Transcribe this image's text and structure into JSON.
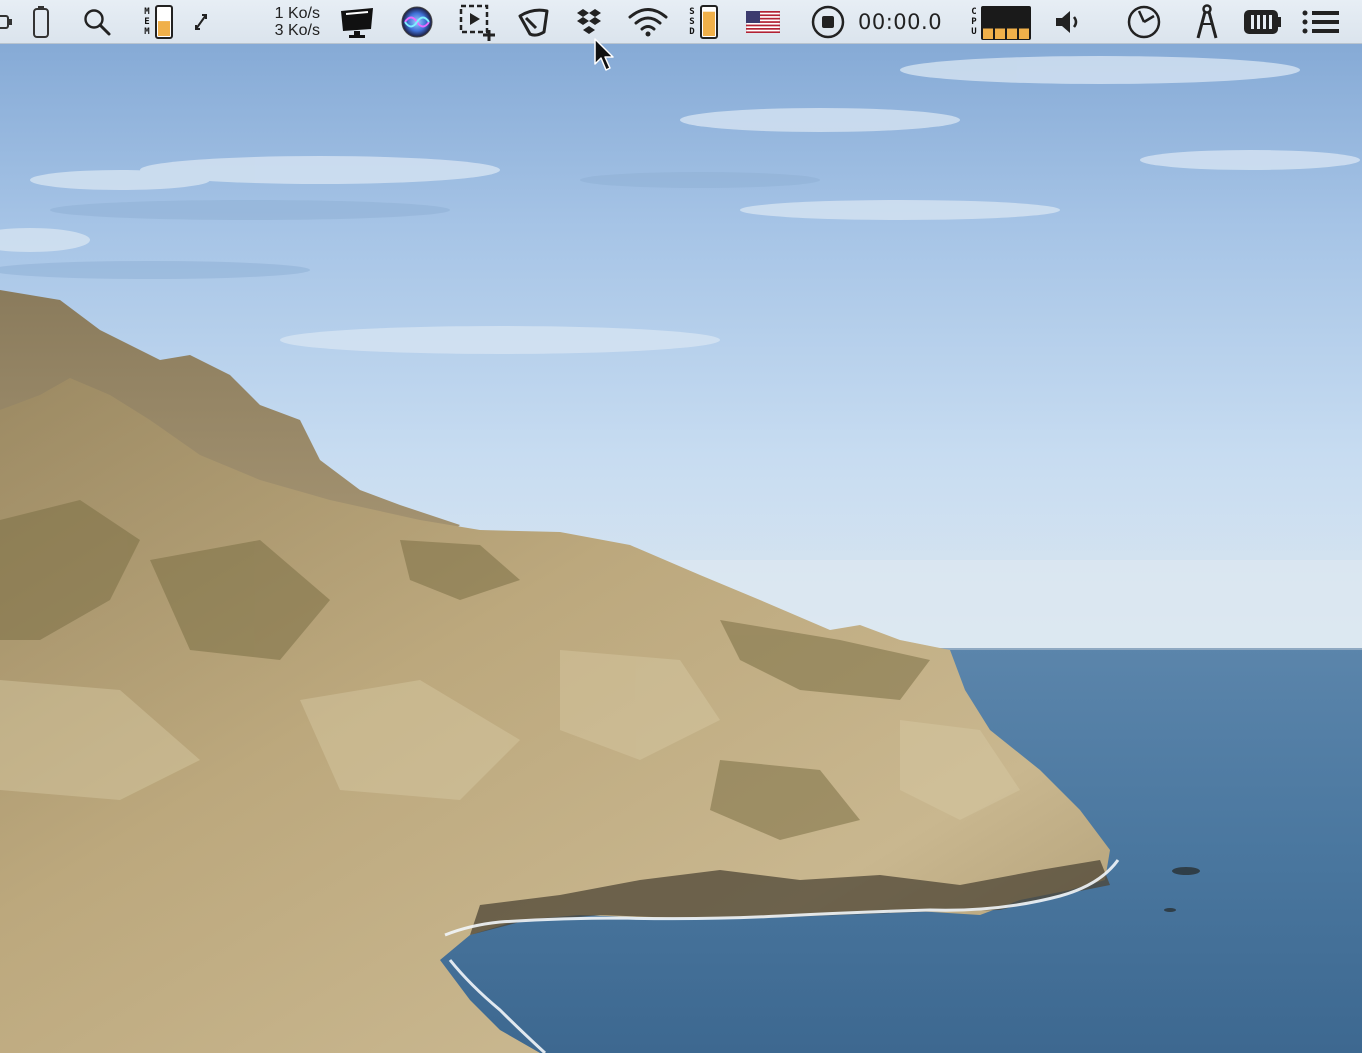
{
  "menubar": {
    "items": [
      {
        "name": "battery-mini-icon"
      },
      {
        "name": "phone-battery-icon"
      },
      {
        "name": "spotlight-search-icon"
      },
      {
        "name": "memory-monitor",
        "label": "MEM",
        "level": 0.55
      },
      {
        "name": "sync-arrows-icon"
      },
      {
        "name": "network-monitor",
        "upload": "1 Ko/s",
        "download": "3 Ko/s"
      },
      {
        "name": "display-presenter-icon"
      },
      {
        "name": "siri-icon"
      },
      {
        "name": "screenshot-capture-icon"
      },
      {
        "name": "shield-icon"
      },
      {
        "name": "dropbox-icon"
      },
      {
        "name": "wifi-icon"
      },
      {
        "name": "ssd-monitor",
        "label": "SSD",
        "level": 0.9
      },
      {
        "name": "us-flag-input-icon"
      },
      {
        "name": "screen-recorder",
        "time": "00:00.0"
      },
      {
        "name": "cpu-monitor",
        "label": "CPU",
        "levels": [
          0.35,
          0.35,
          0.35,
          0.35
        ]
      },
      {
        "name": "volume-icon"
      },
      {
        "name": "clock-icon"
      },
      {
        "name": "compass-tool-icon"
      },
      {
        "name": "battery-gauge-icon"
      },
      {
        "name": "list-menu-icon"
      }
    ]
  },
  "colors": {
    "menubar_bg": "#e3eaf2",
    "accent_orange": "#f0b04a",
    "sky_top": "#7fa6d4",
    "sky_bottom": "#cfe0f1",
    "sea": "#3f6c95",
    "cliff": "#b8a47a"
  }
}
